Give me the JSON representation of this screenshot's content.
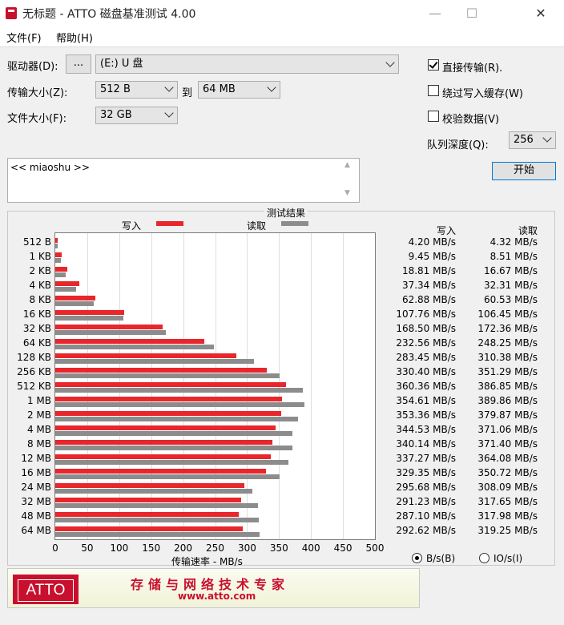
{
  "window": {
    "title": "无标题 - ATTO 磁盘基准测试 4.00",
    "minimize": "—",
    "maximize": "☐",
    "close": "✕"
  },
  "menu": [
    "文件(F)",
    "帮助(H)"
  ],
  "drive": {
    "label": "驱动器(D):",
    "browse": "...",
    "value": "(E:) U 盘"
  },
  "transfer": {
    "label": "传输大小(Z):",
    "from": "512 B",
    "to_label": "到",
    "to": "64 MB"
  },
  "filesize": {
    "label": "文件大小(F):",
    "value": "32 GB"
  },
  "options": {
    "direct_io": "直接传输(R).",
    "bypass_cache": "绕过写入缓存(W)",
    "verify": "校验数据(V)",
    "direct_io_checked": true,
    "bypass_cache_checked": false,
    "verify_checked": false
  },
  "queue": {
    "label": "队列深度(Q):",
    "value": "256"
  },
  "start_button": "开始",
  "description": "<< miaoshu >>",
  "results": {
    "title": "测试结果",
    "write_legend": "写入",
    "read_legend": "读取",
    "col_write": "写入",
    "col_read": "读取"
  },
  "colors": {
    "write": "#e8262b",
    "read": "#8c8c8c"
  },
  "chart_data": {
    "type": "bar",
    "orientation": "horizontal",
    "title": "测试结果",
    "xlabel": "传输速率 - MB/s",
    "xlim": [
      0,
      500
    ],
    "xticks": [
      0,
      50,
      100,
      150,
      200,
      250,
      300,
      350,
      400,
      450,
      500
    ],
    "categories": [
      "512 B",
      "1 KB",
      "2 KB",
      "4 KB",
      "8 KB",
      "16 KB",
      "32 KB",
      "64 KB",
      "128 KB",
      "256 KB",
      "512 KB",
      "1 MB",
      "2 MB",
      "4 MB",
      "8 MB",
      "12 MB",
      "16 MB",
      "24 MB",
      "32 MB",
      "48 MB",
      "64 MB"
    ],
    "series": [
      {
        "name": "写入",
        "values": [
          4.2,
          9.45,
          18.81,
          37.34,
          62.88,
          107.76,
          168.5,
          232.56,
          283.45,
          330.4,
          360.36,
          354.61,
          353.36,
          344.53,
          340.14,
          337.27,
          329.35,
          295.68,
          291.23,
          287.1,
          292.62
        ]
      },
      {
        "name": "读取",
        "values": [
          4.32,
          8.51,
          16.67,
          32.31,
          60.53,
          106.45,
          172.36,
          248.25,
          310.38,
          351.29,
          386.85,
          389.86,
          379.87,
          371.06,
          371.4,
          364.08,
          350.72,
          308.09,
          317.65,
          317.98,
          319.25
        ]
      }
    ],
    "grid": true,
    "legend": "top"
  },
  "write_values": [
    "4.20 MB/s",
    "9.45 MB/s",
    "18.81 MB/s",
    "37.34 MB/s",
    "62.88 MB/s",
    "107.76 MB/s",
    "168.50 MB/s",
    "232.56 MB/s",
    "283.45 MB/s",
    "330.40 MB/s",
    "360.36 MB/s",
    "354.61 MB/s",
    "353.36 MB/s",
    "344.53 MB/s",
    "340.14 MB/s",
    "337.27 MB/s",
    "329.35 MB/s",
    "295.68 MB/s",
    "291.23 MB/s",
    "287.10 MB/s",
    "292.62 MB/s"
  ],
  "read_values": [
    "4.32 MB/s",
    "8.51 MB/s",
    "16.67 MB/s",
    "32.31 MB/s",
    "60.53 MB/s",
    "106.45 MB/s",
    "172.36 MB/s",
    "248.25 MB/s",
    "310.38 MB/s",
    "351.29 MB/s",
    "386.85 MB/s",
    "389.86 MB/s",
    "379.87 MB/s",
    "371.06 MB/s",
    "371.40 MB/s",
    "364.08 MB/s",
    "350.72 MB/s",
    "308.09 MB/s",
    "317.65 MB/s",
    "317.98 MB/s",
    "319.25 MB/s"
  ],
  "units": {
    "bytes": "B/s(B)",
    "io": "IO/s(I)",
    "bytes_selected": true
  },
  "banner": {
    "logo": "ATTO",
    "slogan": "存储与网络技术专家",
    "url": "www.atto.com"
  }
}
